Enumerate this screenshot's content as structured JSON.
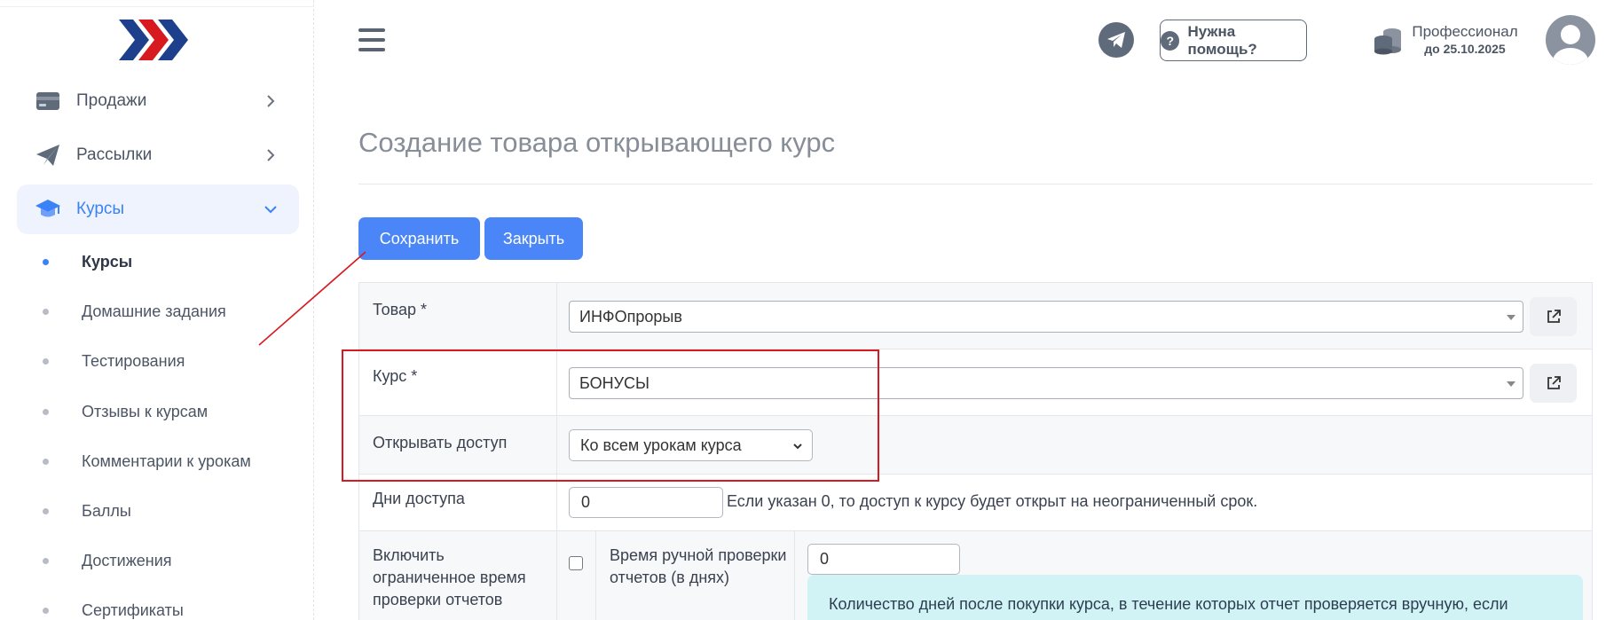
{
  "sidebar": {
    "menu": [
      {
        "label": "Продажи",
        "icon": "wallet-icon"
      },
      {
        "label": "Рассылки",
        "icon": "paper-plane-icon"
      },
      {
        "label": "Курсы",
        "icon": "graduation-cap-icon"
      }
    ],
    "submenu": [
      {
        "label": "Курсы"
      },
      {
        "label": "Домашние задания"
      },
      {
        "label": "Тестирования"
      },
      {
        "label": "Отзывы к курсам"
      },
      {
        "label": "Комментарии к урокам"
      },
      {
        "label": "Баллы"
      },
      {
        "label": "Достижения"
      },
      {
        "label": "Сертификаты"
      }
    ]
  },
  "header": {
    "help_label": "Нужна помощь?",
    "plan_name": "Профессионал",
    "plan_until": "до 25.10.2025"
  },
  "page": {
    "title": "Создание товара открывающего курс",
    "save_label": "Сохранить",
    "close_label": "Закрыть"
  },
  "form": {
    "product_label": "Товар *",
    "product_value": "ИНФОпрорыв",
    "course_label": "Курс *",
    "course_value": "БОНУСЫ",
    "access_label": "Открывать доступ",
    "access_value": "Ко всем урокам курса",
    "days_label": "Дни доступа",
    "days_value": "0",
    "days_hint": "Если указан 0, то доступ к курсу будет открыт на неограниченный срок.",
    "limited_label": "Включить ограниченное время проверки отчетов",
    "manual_label": "Время ручной проверки отчетов (в днях)",
    "manual_value": "0",
    "info_text": "Количество дней после покупки курса, в течение которых отчет проверяется вручную, если"
  },
  "colors": {
    "accent": "#4a86f7",
    "annotation": "#d71920",
    "info_bg": "#d1f3f6"
  }
}
